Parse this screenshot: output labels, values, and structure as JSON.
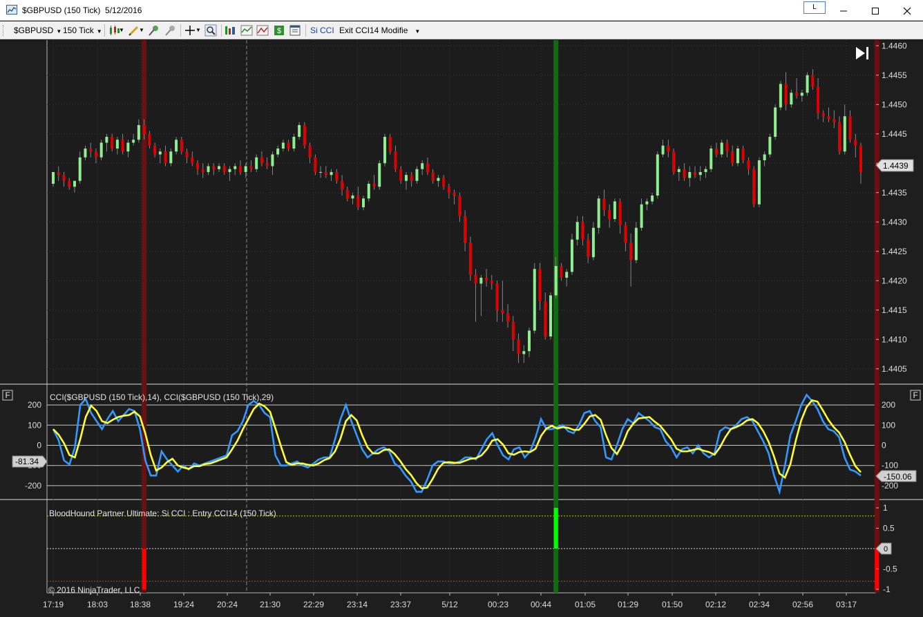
{
  "window": {
    "title": "$GBPUSD (150 Tick)  5/12/2016",
    "link_label": "L",
    "minimize_icon": "minimize-icon",
    "maximize_icon": "maximize-icon",
    "close_icon": "close-icon"
  },
  "toolbar": {
    "instrument": "$GBPUSD",
    "interval": "150 Tick",
    "strategy_name": "Si CCI",
    "exit_strategy": "Exit CCI14 Modifie",
    "icons": [
      "bar-style-icon",
      "drawing-tool-icon",
      "pin-icon",
      "pin-global-icon",
      "crosshair-icon",
      "zoom-icon",
      "data-series-icon",
      "indicators-icon",
      "chart-trader-icon",
      "strategies-icon",
      "properties-icon"
    ]
  },
  "colors": {
    "up_candle": "#90ee90",
    "down_candle": "#e00000",
    "cci_fast": "#3399ff",
    "cci_slow": "#ffff33",
    "exit_marker": "#6b1010",
    "entry_marker": "#0f6b0f",
    "signal_up": "#00ff00",
    "signal_down": "#ff0000"
  },
  "price_panel": {
    "axis_labels": [
      "1.4460",
      "1.4455",
      "1.4450",
      "1.4445",
      "1.4440",
      "1.4435",
      "1.4430",
      "1.4425",
      "1.4420",
      "1.4415",
      "1.4410",
      "1.4405"
    ],
    "current_price": "1.4439",
    "scroll_end_icon": "scroll-to-end-icon"
  },
  "cci_panel": {
    "label": "CCI($GBPUSD (150 Tick),14), CCI($GBPUSD (150 Tick),29)",
    "axis_labels": [
      "200",
      "100",
      "0",
      "-100",
      "-200"
    ],
    "left_axis_labels": [
      "200",
      "100",
      "0",
      "-100",
      "-200"
    ],
    "left_value": "-81.34",
    "right_value": "-150.06",
    "panel_toggle": "F"
  },
  "signal_panel": {
    "label": "BloodHound Partner Ultimate: Si CCI : Entry CCI14 (150 Tick)",
    "axis_labels": [
      "1",
      "0.5",
      "0",
      "-0.5",
      "-1"
    ],
    "current_value": "0",
    "copyright": "© 2016 NinjaTrader, LLC"
  },
  "time_axis": [
    "17:19",
    "18:03",
    "18:38",
    "19:24",
    "20:24",
    "21:30",
    "22:29",
    "23:14",
    "23:37",
    "5/12",
    "00:23",
    "00:44",
    "01:05",
    "01:29",
    "01:50",
    "02:12",
    "02:34",
    "02:56",
    "03:17"
  ],
  "chart_data": {
    "type": "candlestick",
    "instrument": "$GBPUSD",
    "interval": "150 Tick",
    "ylim": [
      1.44025,
      1.44605
    ],
    "candles": [
      [
        1.44365,
        1.44385,
        1.4436,
        1.44385
      ],
      [
        1.44385,
        1.44395,
        1.4437,
        1.4438
      ],
      [
        1.4438,
        1.44385,
        1.4436,
        1.4437
      ],
      [
        1.4437,
        1.44375,
        1.44355,
        1.4436
      ],
      [
        1.4436,
        1.4437,
        1.4435,
        1.4437
      ],
      [
        1.4437,
        1.4442,
        1.44365,
        1.4441
      ],
      [
        1.4441,
        1.4443,
        1.44405,
        1.44425
      ],
      [
        1.44425,
        1.44435,
        1.4441,
        1.4442
      ],
      [
        1.4442,
        1.44425,
        1.444,
        1.4441
      ],
      [
        1.4441,
        1.4444,
        1.44405,
        1.44435
      ],
      [
        1.44435,
        1.4445,
        1.4442,
        1.44445
      ],
      [
        1.44445,
        1.4445,
        1.4442,
        1.44425
      ],
      [
        1.44425,
        1.44445,
        1.44415,
        1.4444
      ],
      [
        1.4444,
        1.4445,
        1.44415,
        1.4442
      ],
      [
        1.4442,
        1.4444,
        1.4441,
        1.44435
      ],
      [
        1.44435,
        1.4445,
        1.4443,
        1.4444
      ],
      [
        1.4444,
        1.44475,
        1.44435,
        1.44465
      ],
      [
        1.44465,
        1.44475,
        1.4444,
        1.4445
      ],
      [
        1.4445,
        1.44455,
        1.44425,
        1.4443
      ],
      [
        1.4443,
        1.44435,
        1.4441,
        1.44415
      ],
      [
        1.44415,
        1.44425,
        1.444,
        1.4442
      ],
      [
        1.4442,
        1.4443,
        1.44395,
        1.444
      ],
      [
        1.444,
        1.44425,
        1.44395,
        1.4442
      ],
      [
        1.4442,
        1.44445,
        1.44415,
        1.4444
      ],
      [
        1.4444,
        1.44445,
        1.44415,
        1.4442
      ],
      [
        1.4442,
        1.44425,
        1.444,
        1.4441
      ],
      [
        1.4441,
        1.4442,
        1.44395,
        1.444
      ],
      [
        1.444,
        1.44405,
        1.4438,
        1.4439
      ],
      [
        1.4439,
        1.444,
        1.44375,
        1.44385
      ],
      [
        1.44385,
        1.444,
        1.4438,
        1.44395
      ],
      [
        1.44395,
        1.444,
        1.4438,
        1.4439
      ],
      [
        1.4439,
        1.444,
        1.44385,
        1.44395
      ],
      [
        1.44395,
        1.444,
        1.4438,
        1.44385
      ],
      [
        1.44385,
        1.44395,
        1.4437,
        1.4439
      ],
      [
        1.4439,
        1.444,
        1.4438,
        1.44395
      ],
      [
        1.44395,
        1.44405,
        1.4438,
        1.44385
      ],
      [
        1.44385,
        1.444,
        1.44375,
        1.44395
      ],
      [
        1.44395,
        1.44405,
        1.44385,
        1.4439
      ],
      [
        1.4439,
        1.44415,
        1.44385,
        1.4441
      ],
      [
        1.4441,
        1.4442,
        1.44395,
        1.444
      ],
      [
        1.444,
        1.4441,
        1.4439,
        1.44395
      ],
      [
        1.44395,
        1.4442,
        1.4438,
        1.44415
      ],
      [
        1.44415,
        1.4443,
        1.4441,
        1.44425
      ],
      [
        1.44425,
        1.4444,
        1.4442,
        1.44435
      ],
      [
        1.44435,
        1.4444,
        1.4442,
        1.44425
      ],
      [
        1.44425,
        1.4445,
        1.4442,
        1.44445
      ],
      [
        1.44445,
        1.4447,
        1.4444,
        1.44465
      ],
      [
        1.44465,
        1.4447,
        1.44425,
        1.4443
      ],
      [
        1.4443,
        1.44435,
        1.444,
        1.4441
      ],
      [
        1.4441,
        1.44415,
        1.4438,
        1.44385
      ],
      [
        1.44385,
        1.44395,
        1.44375,
        1.44385
      ],
      [
        1.44385,
        1.44395,
        1.44375,
        1.4438
      ],
      [
        1.4438,
        1.4439,
        1.4437,
        1.44385
      ],
      [
        1.44385,
        1.4439,
        1.44365,
        1.4437
      ],
      [
        1.4437,
        1.4438,
        1.44345,
        1.44355
      ],
      [
        1.44355,
        1.4436,
        1.44335,
        1.4434
      ],
      [
        1.4434,
        1.4435,
        1.4433,
        1.44345
      ],
      [
        1.44345,
        1.4436,
        1.4432,
        1.44325
      ],
      [
        1.44325,
        1.44345,
        1.4432,
        1.4434
      ],
      [
        1.4434,
        1.4437,
        1.44335,
        1.44365
      ],
      [
        1.44365,
        1.4438,
        1.44355,
        1.4436
      ],
      [
        1.4436,
        1.44405,
        1.44355,
        1.444
      ],
      [
        1.444,
        1.4445,
        1.44395,
        1.44445
      ],
      [
        1.44445,
        1.4445,
        1.44415,
        1.4442
      ],
      [
        1.4442,
        1.4443,
        1.44385,
        1.4439
      ],
      [
        1.4439,
        1.44395,
        1.44365,
        1.4437
      ],
      [
        1.4437,
        1.44385,
        1.44355,
        1.4438
      ],
      [
        1.4438,
        1.44385,
        1.4436,
        1.4437
      ],
      [
        1.4437,
        1.44395,
        1.44365,
        1.4439
      ],
      [
        1.4439,
        1.44405,
        1.4438,
        1.444
      ],
      [
        1.444,
        1.4441,
        1.4438,
        1.44385
      ],
      [
        1.44385,
        1.4439,
        1.44365,
        1.4437
      ],
      [
        1.4437,
        1.4438,
        1.4436,
        1.44375
      ],
      [
        1.44375,
        1.4438,
        1.44355,
        1.4436
      ],
      [
        1.4436,
        1.44365,
        1.4434,
        1.4435
      ],
      [
        1.4435,
        1.44355,
        1.4433,
        1.44345
      ],
      [
        1.44345,
        1.4435,
        1.443,
        1.4431
      ],
      [
        1.4431,
        1.4432,
        1.4425,
        1.44265
      ],
      [
        1.44265,
        1.44275,
        1.442,
        1.4421
      ],
      [
        1.4421,
        1.4422,
        1.4413,
        1.44195
      ],
      [
        1.44195,
        1.4421,
        1.4414,
        1.44205
      ],
      [
        1.44205,
        1.4422,
        1.4419,
        1.442
      ],
      [
        1.442,
        1.4421,
        1.44185,
        1.44195
      ],
      [
        1.44195,
        1.442,
        1.4413,
        1.4415
      ],
      [
        1.4415,
        1.442,
        1.4413,
        1.44145
      ],
      [
        1.44145,
        1.4416,
        1.4412,
        1.4413
      ],
      [
        1.4413,
        1.4414,
        1.4408,
        1.441
      ],
      [
        1.441,
        1.4411,
        1.4406,
        1.44075
      ],
      [
        1.44075,
        1.4409,
        1.4406,
        1.4408
      ],
      [
        1.4408,
        1.4412,
        1.4407,
        1.44115
      ],
      [
        1.44115,
        1.4423,
        1.4411,
        1.4422
      ],
      [
        1.4422,
        1.4423,
        1.4415,
        1.44165
      ],
      [
        1.44165,
        1.4418,
        1.441,
        1.44105
      ],
      [
        1.44105,
        1.4418,
        1.441,
        1.44175
      ],
      [
        1.44175,
        1.4424,
        1.4417,
        1.44225
      ],
      [
        1.44225,
        1.4423,
        1.442,
        1.44205
      ],
      [
        1.44205,
        1.4422,
        1.4419,
        1.44215
      ],
      [
        1.44215,
        1.4428,
        1.4421,
        1.4427
      ],
      [
        1.4427,
        1.4431,
        1.4426,
        1.443
      ],
      [
        1.443,
        1.4431,
        1.4426,
        1.4427
      ],
      [
        1.4427,
        1.4428,
        1.4423,
        1.4424
      ],
      [
        1.4424,
        1.443,
        1.44235,
        1.4429
      ],
      [
        1.4429,
        1.44345,
        1.4428,
        1.4434
      ],
      [
        1.4434,
        1.44355,
        1.4431,
        1.4432
      ],
      [
        1.4432,
        1.4433,
        1.4429,
        1.44305
      ],
      [
        1.44305,
        1.4434,
        1.443,
        1.44335
      ],
      [
        1.44335,
        1.4434,
        1.4428,
        1.44295
      ],
      [
        1.44295,
        1.443,
        1.4425,
        1.44265
      ],
      [
        1.44265,
        1.4428,
        1.4419,
        1.44235
      ],
      [
        1.44235,
        1.443,
        1.4423,
        1.4429
      ],
      [
        1.4429,
        1.4434,
        1.44285,
        1.4433
      ],
      [
        1.4433,
        1.4434,
        1.4432,
        1.44335
      ],
      [
        1.44335,
        1.4435,
        1.4433,
        1.44345
      ],
      [
        1.44345,
        1.4442,
        1.4434,
        1.44415
      ],
      [
        1.44415,
        1.4444,
        1.4441,
        1.4443
      ],
      [
        1.4443,
        1.4444,
        1.4441,
        1.4442
      ],
      [
        1.4442,
        1.44425,
        1.4438,
        1.44385
      ],
      [
        1.44385,
        1.44395,
        1.4437,
        1.4439
      ],
      [
        1.4439,
        1.444,
        1.4437,
        1.44375
      ],
      [
        1.44375,
        1.44395,
        1.4436,
        1.44385
      ],
      [
        1.44385,
        1.44395,
        1.44375,
        1.4438
      ],
      [
        1.4438,
        1.44395,
        1.4437,
        1.44385
      ],
      [
        1.44385,
        1.44395,
        1.44375,
        1.4439
      ],
      [
        1.4439,
        1.4443,
        1.44385,
        1.44425
      ],
      [
        1.44425,
        1.44435,
        1.4441,
        1.44415
      ],
      [
        1.44415,
        1.4444,
        1.4441,
        1.44435
      ],
      [
        1.44435,
        1.4444,
        1.4441,
        1.4442
      ],
      [
        1.4442,
        1.4443,
        1.44395,
        1.444
      ],
      [
        1.444,
        1.4443,
        1.44395,
        1.44425
      ],
      [
        1.44425,
        1.4443,
        1.444,
        1.44405
      ],
      [
        1.44405,
        1.4441,
        1.4438,
        1.4439
      ],
      [
        1.4439,
        1.44395,
        1.44325,
        1.4433
      ],
      [
        1.4433,
        1.4441,
        1.44325,
        1.44405
      ],
      [
        1.44405,
        1.4442,
        1.44395,
        1.44415
      ],
      [
        1.44415,
        1.4445,
        1.4441,
        1.44445
      ],
      [
        1.44445,
        1.445,
        1.4444,
        1.44495
      ],
      [
        1.44495,
        1.4454,
        1.4449,
        1.44535
      ],
      [
        1.44535,
        1.44555,
        1.4449,
        1.445
      ],
      [
        1.445,
        1.44525,
        1.44495,
        1.4452
      ],
      [
        1.4452,
        1.44545,
        1.4451,
        1.44515
      ],
      [
        1.44515,
        1.44525,
        1.44505,
        1.4452
      ],
      [
        1.4452,
        1.44555,
        1.44515,
        1.4455
      ],
      [
        1.4455,
        1.4456,
        1.44525,
        1.4453
      ],
      [
        1.4453,
        1.44545,
        1.44475,
        1.44485
      ],
      [
        1.44485,
        1.4449,
        1.4447,
        1.4448
      ],
      [
        1.4448,
        1.44495,
        1.4447,
        1.44475
      ],
      [
        1.44475,
        1.4449,
        1.4446,
        1.4447
      ],
      [
        1.4447,
        1.4448,
        1.44415,
        1.4442
      ],
      [
        1.4442,
        1.445,
        1.44415,
        1.4448
      ],
      [
        1.4448,
        1.4449,
        1.44435,
        1.4444
      ],
      [
        1.4444,
        1.4445,
        1.4441,
        1.4443
      ],
      [
        1.4443,
        1.44435,
        1.44365,
        1.44385
      ]
    ],
    "markers": [
      {
        "type": "exit",
        "bar": 17
      },
      {
        "type": "entry",
        "bar": 94
      },
      {
        "type": "exit",
        "bar": 154
      }
    ],
    "cci14": [
      80,
      25,
      -75,
      -95,
      -10,
      200,
      230,
      160,
      120,
      80,
      130,
      170,
      120,
      150,
      180,
      170,
      80,
      -75,
      -150,
      -150,
      -30,
      -70,
      -100,
      -130,
      -100,
      -120,
      -90,
      -100,
      -90,
      -80,
      -70,
      -60,
      -50,
      50,
      70,
      120,
      200,
      220,
      200,
      160,
      140,
      -50,
      -100,
      -100,
      -90,
      -80,
      -100,
      -110,
      -90,
      -70,
      -60,
      -60,
      30,
      130,
      200,
      120,
      50,
      -20,
      -60,
      -40,
      -20,
      -10,
      -30,
      -90,
      -110,
      -150,
      -180,
      -230,
      -230,
      -170,
      -100,
      -80,
      -80,
      -90,
      -90,
      -80,
      -60,
      -60,
      -70,
      -20,
      30,
      60,
      0,
      -50,
      -70,
      -20,
      -10,
      -60,
      -30,
      40,
      130,
      80,
      80,
      90,
      100,
      70,
      60,
      100,
      160,
      170,
      120,
      90,
      -60,
      -70,
      0,
      80,
      130,
      110,
      160,
      140,
      120,
      90,
      80,
      20,
      -10,
      -60,
      -20,
      -10,
      -40,
      0,
      -40,
      -60,
      -40,
      70,
      90,
      80,
      100,
      130,
      140,
      120,
      70,
      20,
      -40,
      -150,
      -230,
      -100,
      50,
      120,
      200,
      250,
      220,
      180,
      120,
      80,
      70,
      40,
      -60,
      -120,
      -130,
      -150
    ]
  }
}
